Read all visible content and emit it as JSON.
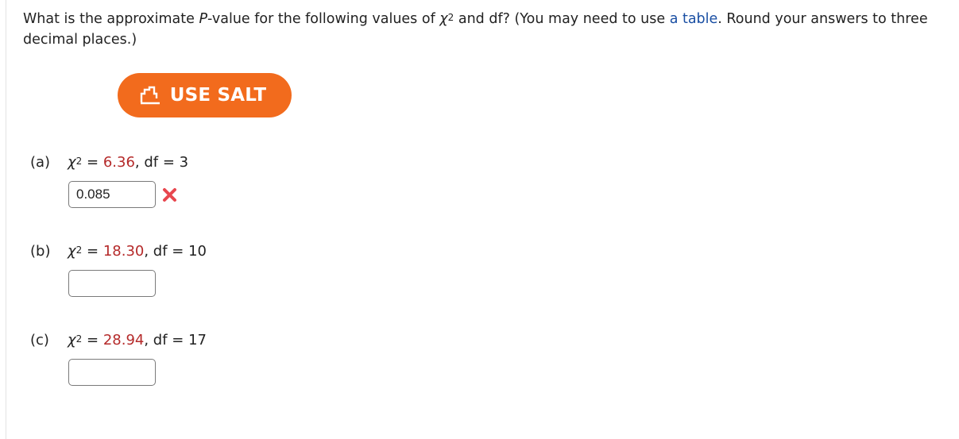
{
  "question": {
    "text_before_p": "What is the approximate ",
    "p_symbol": "P",
    "text_after_p": "-value for the following values of ",
    "chi_symbol": "χ",
    "exponent": "2",
    "text_after_chi": " and df? (You may need to use ",
    "link_text": "a table",
    "text_end": ". Round your answers to three decimal places.)"
  },
  "salt_button": {
    "label": "USE SALT",
    "icon": "salt-logo-icon"
  },
  "parts": [
    {
      "label": "(a)",
      "chi_symbol": "χ",
      "exponent": "2",
      "equals": " = ",
      "chi_value": "6.36",
      "df_text": ", df = 3",
      "answer_value": "0.085",
      "status": "incorrect"
    },
    {
      "label": "(b)",
      "chi_symbol": "χ",
      "exponent": "2",
      "equals": " = ",
      "chi_value": "18.30",
      "df_text": ", df = 10",
      "answer_value": ""
    },
    {
      "label": "(c)",
      "chi_symbol": "χ",
      "exponent": "2",
      "equals": " = ",
      "chi_value": "28.94",
      "df_text": ", df = 17",
      "answer_value": ""
    }
  ],
  "colors": {
    "salt_orange": "#f26b1d",
    "value_red": "#b52a2a",
    "link_blue": "#1a4fa3",
    "incorrect_mark": "#e8474f"
  }
}
